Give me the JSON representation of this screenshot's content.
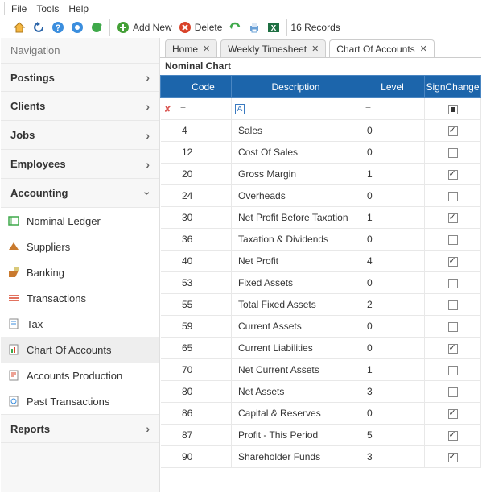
{
  "menubar": {
    "file": "File",
    "tools": "Tools",
    "help": "Help"
  },
  "toolbar": {
    "addnew": "Add New",
    "delete": "Delete",
    "records": "16 Records"
  },
  "nav": {
    "title": "Navigation",
    "postings": "Postings",
    "clients": "Clients",
    "jobs": "Jobs",
    "employees": "Employees",
    "accounting": "Accounting",
    "reports": "Reports",
    "sub": {
      "nominal": "Nominal Ledger",
      "suppliers": "Suppliers",
      "banking": "Banking",
      "transactions": "Transactions",
      "tax": "Tax",
      "coa": "Chart Of Accounts",
      "ap": "Accounts Production",
      "past": "Past Transactions"
    }
  },
  "tabs": {
    "home": "Home",
    "weekly": "Weekly Timesheet",
    "coa": "Chart Of Accounts"
  },
  "grid": {
    "subtitle": "Nominal Chart",
    "cols": {
      "code": "Code",
      "desc": "Description",
      "level": "Level",
      "sign": "SignChange"
    },
    "rows": [
      {
        "code": "4",
        "desc": "Sales",
        "level": "0",
        "sign": true
      },
      {
        "code": "12",
        "desc": "Cost Of Sales",
        "level": "0",
        "sign": false
      },
      {
        "code": "20",
        "desc": "Gross Margin",
        "level": "1",
        "sign": true
      },
      {
        "code": "24",
        "desc": "Overheads",
        "level": "0",
        "sign": false
      },
      {
        "code": "30",
        "desc": "Net Profit Before Taxation",
        "level": "1",
        "sign": true
      },
      {
        "code": "36",
        "desc": "Taxation & Dividends",
        "level": "0",
        "sign": false
      },
      {
        "code": "40",
        "desc": "Net Profit",
        "level": "4",
        "sign": true
      },
      {
        "code": "53",
        "desc": "Fixed Assets",
        "level": "0",
        "sign": false
      },
      {
        "code": "55",
        "desc": "Total Fixed Assets",
        "level": "2",
        "sign": false
      },
      {
        "code": "59",
        "desc": "Current Assets",
        "level": "0",
        "sign": false
      },
      {
        "code": "65",
        "desc": "Current Liabilities",
        "level": "0",
        "sign": true
      },
      {
        "code": "70",
        "desc": "Net Current Assets",
        "level": "1",
        "sign": false
      },
      {
        "code": "80",
        "desc": "Net Assets",
        "level": "3",
        "sign": false
      },
      {
        "code": "86",
        "desc": "Capital & Reserves",
        "level": "0",
        "sign": true
      },
      {
        "code": "87",
        "desc": "Profit - This Period",
        "level": "5",
        "sign": true
      },
      {
        "code": "90",
        "desc": "Shareholder Funds",
        "level": "3",
        "sign": true
      }
    ]
  }
}
